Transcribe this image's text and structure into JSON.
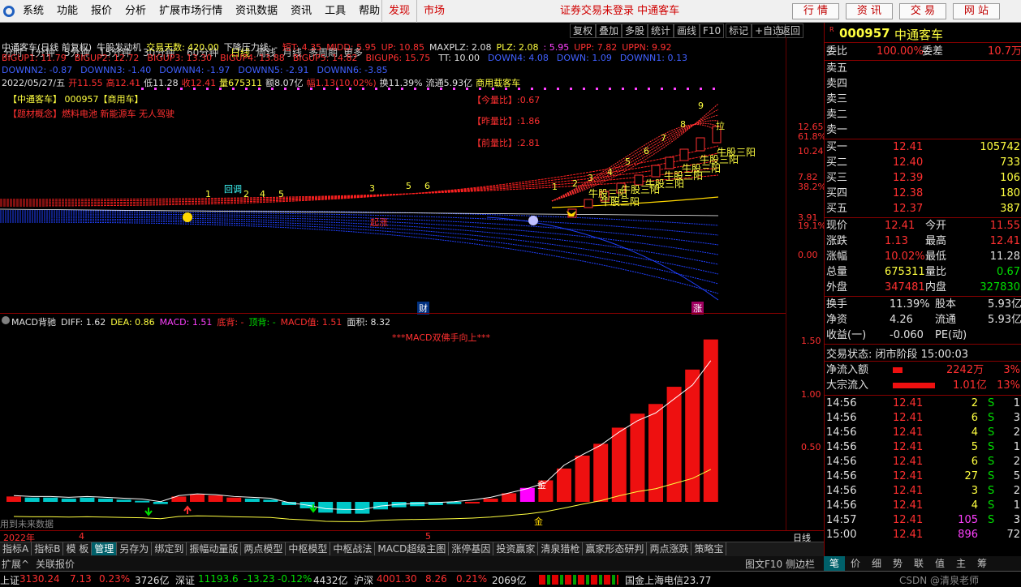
{
  "menu": {
    "items": [
      "系统",
      "功能",
      "报价",
      "分析",
      "扩展市场行情",
      "资讯数据",
      "资讯",
      "工具",
      "帮助"
    ],
    "hot_items": [
      "发现",
      "市场"
    ],
    "login_status": "证券交易未登录  中通客车",
    "right_buttons": [
      "行 情",
      "资 讯",
      "交 易",
      "网 站"
    ]
  },
  "toolbar": {
    "periods": [
      "分时",
      "1分钟",
      "5分钟",
      "15分钟",
      "30分钟",
      "60分钟",
      "日线",
      "周线",
      "月线",
      "多周期",
      "更多"
    ],
    "active_period": "日线",
    "buttons": [
      "复权",
      "叠加",
      "多股",
      "统计",
      "画线",
      "F10",
      "标记",
      "+自选",
      "返回"
    ]
  },
  "indicator1": {
    "line1_parts": [
      {
        "t": "中通客车(日线 前复权)",
        "c": "wht"
      },
      {
        "t": "牛股发动机",
        "c": "wht"
      },
      {
        "t": "交易天数: 420.00",
        "c": "yel"
      },
      {
        "t": "下降压力线: -",
        "c": "wht"
      },
      {
        "t": "短T: 4.35",
        "c": "red"
      },
      {
        "t": "MIDD: 5.95",
        "c": "red"
      },
      {
        "t": "UP: 10.85",
        "c": "red"
      },
      {
        "t": "MAXPLZ: 2.08",
        "c": "wht"
      },
      {
        "t": "PLZ: 2.08",
        "c": "yel"
      },
      {
        "t": ": 5.95",
        "c": "mag"
      },
      {
        "t": "UPP: 7.82",
        "c": "red"
      },
      {
        "t": "UPPN: 9.92",
        "c": "red"
      }
    ],
    "line2_parts": [
      {
        "t": "BIGUP1: 11.79",
        "c": "red"
      },
      {
        "t": "BIGUP2: 12.72",
        "c": "red"
      },
      {
        "t": "BIGUP3: 13.30",
        "c": "red"
      },
      {
        "t": "BIGUP4: 13.88",
        "c": "red"
      },
      {
        "t": "BIGUP5: 14.82",
        "c": "red"
      },
      {
        "t": "BIGUP6: 15.75",
        "c": "red"
      },
      {
        "t": "TT: 10.00",
        "c": "wht"
      },
      {
        "t": "DOWN4: 4.08",
        "c": "blu"
      },
      {
        "t": "DOWN: 1.09",
        "c": "blu"
      },
      {
        "t": "DOWNN1: 0.13",
        "c": "blu"
      }
    ],
    "line3_parts": [
      {
        "t": "DOWNN2: -0.87",
        "c": "blu"
      },
      {
        "t": "DOWNN3: -1.40",
        "c": "blu"
      },
      {
        "t": "DOWNN4: -1.97",
        "c": "blu"
      },
      {
        "t": "DOWNN5: -2.91",
        "c": "blu"
      },
      {
        "t": "DOWNN6: -3.85",
        "c": "blu"
      }
    ],
    "line4_parts": [
      {
        "t": "2022/05/27/五",
        "c": "wht"
      },
      {
        "t": "开11.55",
        "c": "red"
      },
      {
        "t": "高12.41",
        "c": "red"
      },
      {
        "t": "低11.28",
        "c": "wht"
      },
      {
        "t": "收12.41",
        "c": "red"
      },
      {
        "t": "量675311",
        "c": "yel"
      },
      {
        "t": "额8.07亿",
        "c": "wht"
      },
      {
        "t": "幅1.13(10.02%)",
        "c": "red"
      },
      {
        "t": "换11.39%",
        "c": "wht"
      },
      {
        "t": "流通5.93亿",
        "c": "wht"
      },
      {
        "t": "商用载客车",
        "c": "yel"
      }
    ]
  },
  "annotations": {
    "stock_tag": "【中通客车】 000957【商用车】",
    "concept": "【题材概念】燃料电池 新能源车 无人驾驶",
    "vol_ratio_today": "【今量比】:0.67",
    "vol_ratio_yday": "【昨量比】:1.86",
    "vol_ratio_prev": "【前量比】:2.81",
    "huitiao": "回调",
    "qizhang": "起涨",
    "niugu": "牛股三阳",
    "la": "拉",
    "cai": "财",
    "zhang": "涨",
    "jin": "金",
    "macd_double": "***MACD双佛手向上***",
    "future_data": "用到未来数据"
  },
  "axis1": [
    "12.65",
    "61.8%",
    "10.24",
    "7.82",
    "38.2%",
    "3.91",
    "19.1%",
    "0.00"
  ],
  "indicator2": {
    "parts": [
      {
        "t": "MACD背驰",
        "c": "wht"
      },
      {
        "t": "DIFF: 1.62",
        "c": "wht"
      },
      {
        "t": "DEA: 0.86",
        "c": "yel"
      },
      {
        "t": "MACD: 1.51",
        "c": "mag"
      },
      {
        "t": "底背: -",
        "c": "red"
      },
      {
        "t": "顶背: -",
        "c": "grn"
      },
      {
        "t": "MACD值: 1.51",
        "c": "red"
      },
      {
        "t": "面积: 8.32",
        "c": "wht"
      }
    ]
  },
  "axis2": [
    "1.50",
    "1.00",
    "0.50"
  ],
  "dateaxis": {
    "year": "2022年",
    "m4": "4",
    "m5": "5",
    "label": "日线"
  },
  "tabs": [
    "指标A",
    "指标B",
    "模 板",
    "管理",
    "另存为",
    "绑定到",
    "振幅动量版",
    "两点模型",
    "中枢模型",
    "中枢战法",
    "MACD超级主图",
    "涨停基因",
    "投资赢家",
    "清泉猎枪",
    "赢家形态研判",
    "两点涨跌",
    "策略宝"
  ],
  "active_tab": "管理",
  "tabs2": {
    "left": "扩展^",
    "left2": "关联报价",
    "right": "图文F10",
    "right2": "侧边栏《"
  },
  "side": {
    "code": "000957",
    "name": "中通客车",
    "weibi_label": "委比",
    "weibi": "100.00%",
    "weicha_label": "委差",
    "weicha": "10.7万",
    "sells": [
      {
        "label": "卖五",
        "price": "",
        "vol": ""
      },
      {
        "label": "卖四",
        "price": "",
        "vol": ""
      },
      {
        "label": "卖三",
        "price": "",
        "vol": ""
      },
      {
        "label": "卖二",
        "price": "",
        "vol": ""
      },
      {
        "label": "卖一",
        "price": "",
        "vol": ""
      }
    ],
    "buys": [
      {
        "label": "买一",
        "price": "12.41",
        "vol": "105742"
      },
      {
        "label": "买二",
        "price": "12.40",
        "vol": "733"
      },
      {
        "label": "买三",
        "price": "12.39",
        "vol": "106"
      },
      {
        "label": "买四",
        "price": "12.38",
        "vol": "180"
      },
      {
        "label": "买五",
        "price": "12.37",
        "vol": "387"
      }
    ],
    "stats": [
      {
        "l1": "现价",
        "v1": "12.41",
        "c1": "red",
        "l2": "今开",
        "v2": "11.55",
        "c2": "red"
      },
      {
        "l1": "涨跌",
        "v1": "1.13",
        "c1": "red",
        "l2": "最高",
        "v2": "12.41",
        "c2": "red"
      },
      {
        "l1": "涨幅",
        "v1": "10.02%",
        "c1": "red",
        "l2": "最低",
        "v2": "11.28",
        "c2": "wht"
      },
      {
        "l1": "总量",
        "v1": "675311",
        "c1": "yel",
        "l2": "量比",
        "v2": "0.67",
        "c2": "grn"
      },
      {
        "l1": "外盘",
        "v1": "347481",
        "c1": "red",
        "l2": "内盘",
        "v2": "327830",
        "c2": "grn"
      }
    ],
    "stats2": [
      {
        "l1": "换手",
        "v1": "11.39%",
        "l2": "股本",
        "v2": "5.93亿"
      },
      {
        "l1": "净资",
        "v1": "4.26",
        "l2": "流通",
        "v2": "5.93亿"
      },
      {
        "l1": "收益(一)",
        "v1": "-0.060",
        "l2": "PE(动)",
        "v2": ""
      }
    ],
    "trade_status": "交易状态: 闭市阶段 15:00:03",
    "net_inflow_label": "净流入额",
    "net_inflow": "2242万",
    "net_inflow_pct": "3%",
    "block_inflow_label": "大宗流入",
    "block_inflow": "1.01亿",
    "block_inflow_pct": "13%",
    "ticks": [
      {
        "t": "14:56",
        "p": "12.41",
        "v": "2",
        "s": "S",
        "n": "1"
      },
      {
        "t": "14:56",
        "p": "12.41",
        "v": "6",
        "s": "S",
        "n": "3"
      },
      {
        "t": "14:56",
        "p": "12.41",
        "v": "4",
        "s": "S",
        "n": "2"
      },
      {
        "t": "14:56",
        "p": "12.41",
        "v": "5",
        "s": "S",
        "n": "1"
      },
      {
        "t": "14:56",
        "p": "12.41",
        "v": "6",
        "s": "S",
        "n": "2"
      },
      {
        "t": "14:56",
        "p": "12.41",
        "v": "27",
        "s": "S",
        "n": "5"
      },
      {
        "t": "14:56",
        "p": "12.41",
        "v": "3",
        "s": "S",
        "n": "2"
      },
      {
        "t": "14:56",
        "p": "12.41",
        "v": "4",
        "s": "S",
        "n": "1"
      },
      {
        "t": "14:57",
        "p": "12.41",
        "v": "105",
        "s": "S",
        "n": "3"
      },
      {
        "t": "15:00",
        "p": "12.41",
        "v": "896",
        "s": "",
        "n": "72"
      }
    ],
    "tabs": [
      "笔",
      "价",
      "细",
      "势",
      "联",
      "值",
      "主",
      "筹"
    ]
  },
  "status": {
    "sh_label": "上证",
    "sh": "3130.24",
    "sh_chg": "7.13",
    "sh_pct": "0.23%",
    "sh_amt": "3726亿",
    "sz_label": "深证",
    "sz": "11193.6",
    "sz_chg": "-13.23",
    "sz_pct": "-0.12%",
    "sz_amt": "4432亿",
    "hs_label": "沪深",
    "hs": "4001.30",
    "hs_chg": "8.26",
    "hs_pct": "0.21%",
    "hs_amt": "2069亿",
    "server": "国金上海电信23.77",
    "watermark": "CSDN @清泉老师"
  },
  "chart_data": {
    "type": "bar",
    "title": "MACD背驰",
    "macd_values": [
      0.05,
      0.04,
      0.04,
      0.03,
      0.04,
      0.03,
      0.02,
      0.01,
      -0.02,
      0.05,
      0.07,
      0.06,
      0.04,
      0.03,
      0.02,
      -0.03,
      -0.06,
      -0.1,
      -0.11,
      -0.11,
      -0.07,
      -0.05,
      -0.04,
      -0.03,
      -0.02,
      0.0,
      0.03,
      0.08,
      0.13,
      0.2,
      0.31,
      0.43,
      0.54,
      0.69,
      0.82,
      0.91,
      1.07,
      1.23,
      1.51
    ],
    "ylim": [
      -0.2,
      1.6
    ]
  }
}
